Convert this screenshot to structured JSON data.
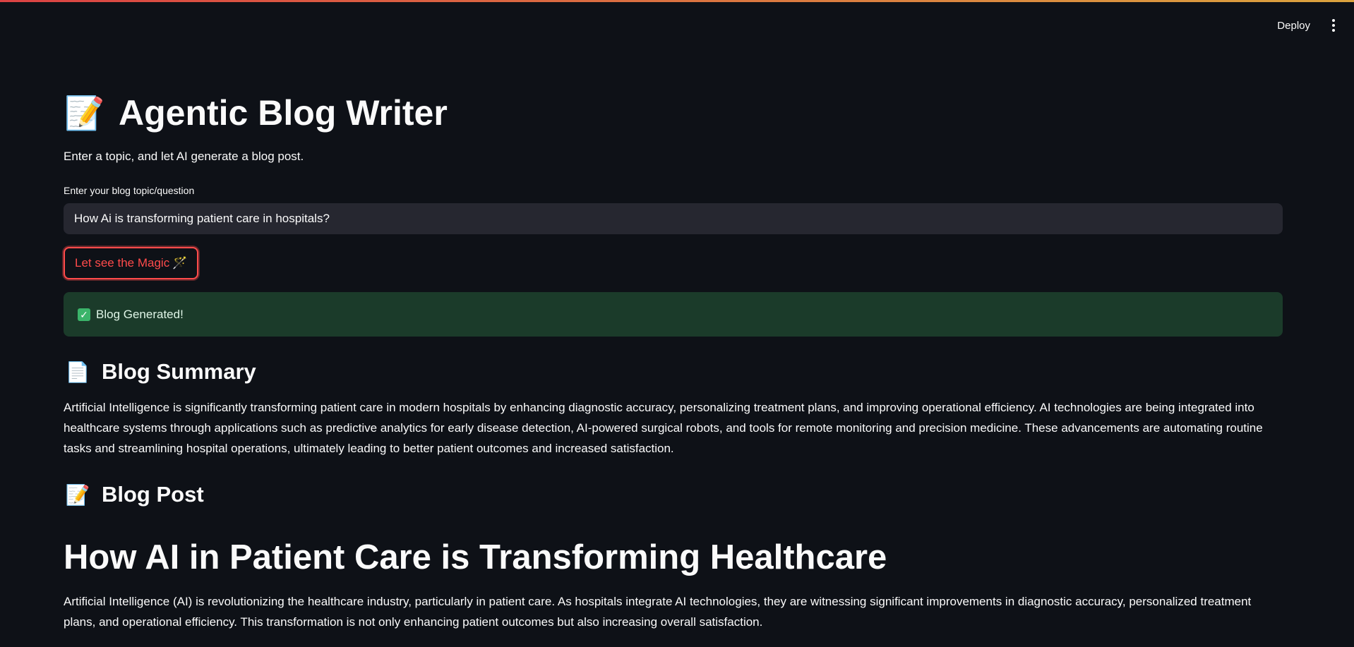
{
  "header": {
    "deploy_label": "Deploy",
    "menu_icon": "kebab-menu-icon"
  },
  "app": {
    "title_emoji": "📝",
    "title": "Agentic Blog Writer",
    "subtitle": "Enter a topic, and let AI generate a blog post."
  },
  "form": {
    "topic_label": "Enter your blog topic/question",
    "topic_value": "How Ai is transforming patient care in hospitals?",
    "submit_label": "Let see the Magic",
    "submit_emoji": "🪄"
  },
  "status": {
    "icon": "check-icon",
    "check_glyph": "✓",
    "message": "Blog Generated!"
  },
  "summary": {
    "emoji": "📄",
    "heading": "Blog Summary",
    "text": "Artificial Intelligence is significantly transforming patient care in modern hospitals by enhancing diagnostic accuracy, personalizing treatment plans, and improving operational efficiency. AI technologies are being integrated into healthcare systems through applications such as predictive analytics for early disease detection, AI-powered surgical robots, and tools for remote monitoring and precision medicine. These advancements are automating routine tasks and streamlining hospital operations, ultimately leading to better patient outcomes and increased satisfaction."
  },
  "post": {
    "emoji": "📝",
    "heading": "Blog Post",
    "title": "How AI in Patient Care is Transforming Healthcare",
    "intro": "Artificial Intelligence (AI) is revolutionizing the healthcare industry, particularly in patient care. As hospitals integrate AI technologies, they are witnessing significant improvements in diagnostic accuracy, personalized treatment plans, and operational efficiency. This transformation is not only enhancing patient outcomes but also increasing overall satisfaction."
  },
  "colors": {
    "background": "#0e1117",
    "accent": "#ff4b4b",
    "success_bg": "#1b3b2a",
    "input_bg": "#262730"
  }
}
